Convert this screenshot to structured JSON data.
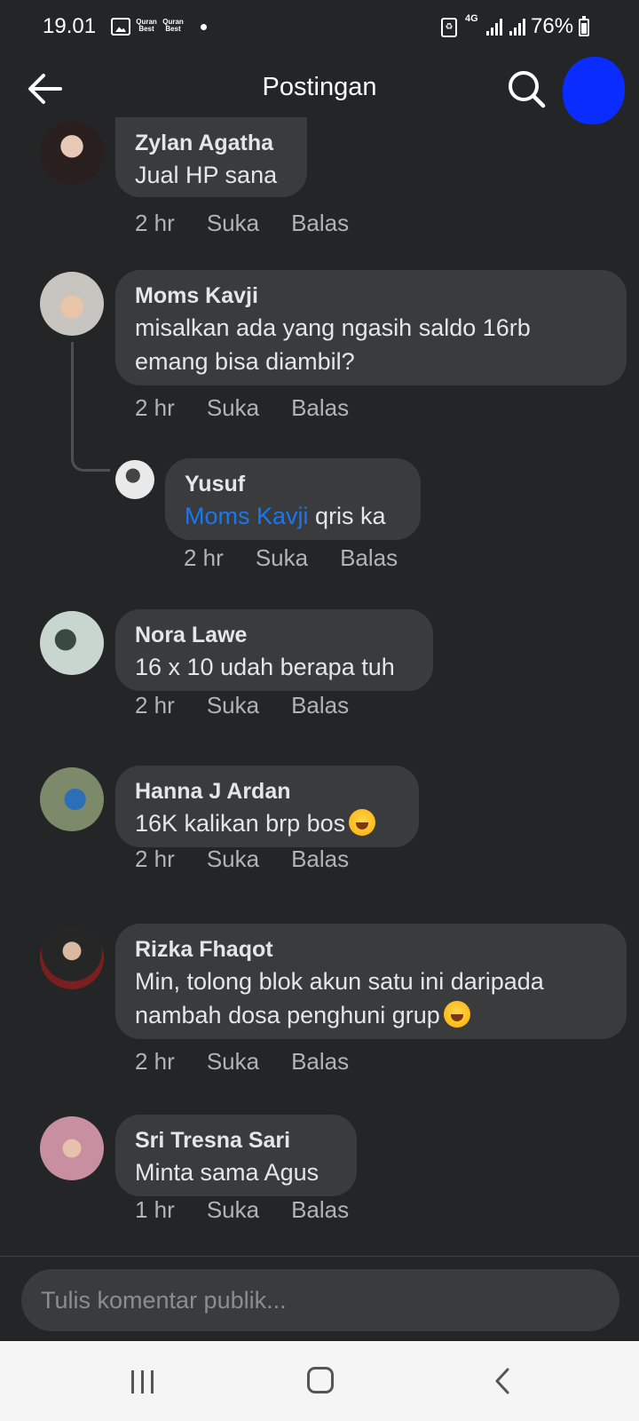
{
  "status_bar": {
    "time": "19.01",
    "notif_label_1": "Quran Best",
    "notif_label_2": "Quran Best",
    "network": "4G",
    "battery": "76%"
  },
  "header": {
    "title": "Postingan"
  },
  "comments": [
    {
      "name": "Zylan Agatha",
      "text": "Jual HP sana",
      "time": "2 hr",
      "like": "Suka",
      "reply": "Balas"
    },
    {
      "name": "Moms Kavji",
      "text_line1": "misalkan ada yang ngasih saldo 16rb",
      "text_line2": "emang bisa diambil?",
      "time": "2 hr",
      "like": "Suka",
      "reply": "Balas"
    },
    {
      "name": "Yusuf",
      "mention": "Moms Kavji",
      "text": "qris ka",
      "time": "2 hr",
      "like": "Suka",
      "reply": "Balas"
    },
    {
      "name": "Nora Lawe",
      "text": "16 x 10 udah berapa tuh",
      "time": "2 hr",
      "like": "Suka",
      "reply": "Balas"
    },
    {
      "name": "Hanna J Ardan",
      "text": "16K kalikan brp bos",
      "time": "2 hr",
      "like": "Suka",
      "reply": "Balas"
    },
    {
      "name": "Rizka Fhaqot",
      "text_line1": "Min, tolong blok akun satu ini daripada",
      "text_line2": "nambah dosa penghuni grup",
      "time": "2 hr",
      "like": "Suka",
      "reply": "Balas"
    },
    {
      "name": "Sri Tresna Sari",
      "text": "Minta sama Agus",
      "time": "1 hr",
      "like": "Suka",
      "reply": "Balas"
    }
  ],
  "composer": {
    "placeholder": "Tulis komentar publik..."
  },
  "colors": {
    "background": "#242526",
    "bubble": "#3a3b3c",
    "mention": "#1877f2",
    "meta": "#b0b3b8"
  }
}
